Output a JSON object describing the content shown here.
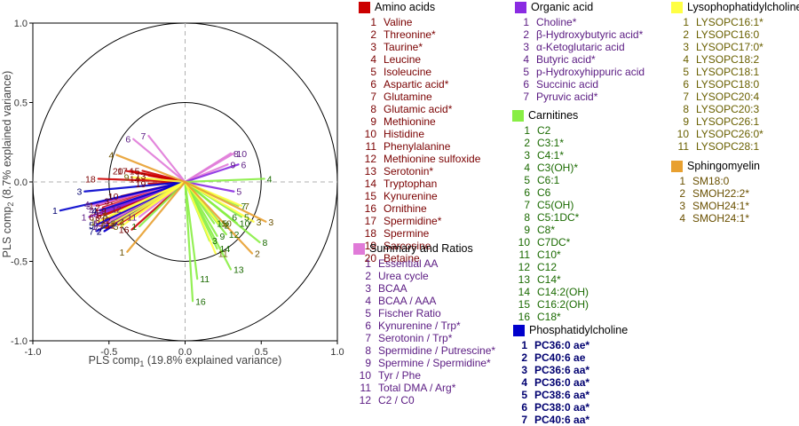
{
  "chart_data": {
    "type": "scatter",
    "subtype": "pls-correlation-loadings",
    "xlabel": "PLS comp",
    "xlabel_sub": "1",
    "xlabel_note": "(19.8% explained variance)",
    "ylabel": "PLS comp",
    "ylabel_sub": "2",
    "ylabel_note": "(8.7% explained variance)",
    "xlim": [
      -1.0,
      1.0
    ],
    "ylim": [
      -1.0,
      1.0
    ],
    "xticks": [
      "-1.0",
      "-0.5",
      "0.0",
      "0.5",
      "1.0"
    ],
    "yticks": [
      "1.0",
      "0.5",
      "0.0",
      "-0.5",
      "-1.0"
    ],
    "circles": [
      1.0,
      0.5
    ],
    "groups": [
      {
        "name": "Amino acids",
        "color": "#cc0000",
        "text_color": "#7a0000",
        "items": [
          "Valine",
          "Threonine*",
          "Taurine*",
          "Leucine",
          "Isoleucine",
          "Aspartic acid*",
          "Glutamine",
          "Glutamic acid*",
          "Methionine",
          "Histidine",
          "Phenylalanine",
          "Methionine sulfoxide",
          "Serotonin*",
          "Tryptophan",
          "Kynurenine",
          "Ornithine",
          "Spermidine*",
          "Spermine",
          "Sarcosine",
          "Betaine"
        ],
        "points": [
          {
            "label": "1",
            "x": -0.58,
            "y": -0.15
          },
          {
            "label": "2",
            "x": -0.54,
            "y": -0.16
          },
          {
            "label": "3",
            "x": -0.48,
            "y": -0.12
          },
          {
            "label": "4",
            "x": -0.55,
            "y": -0.19
          },
          {
            "label": "5",
            "x": -0.53,
            "y": -0.21
          },
          {
            "label": "6",
            "x": -0.58,
            "y": -0.22
          },
          {
            "label": "7",
            "x": -0.52,
            "y": -0.29
          },
          {
            "label": "8",
            "x": -0.54,
            "y": -0.24
          },
          {
            "label": "9",
            "x": -0.5,
            "y": -0.18
          },
          {
            "label": "10",
            "x": -0.42,
            "y": -0.09
          },
          {
            "label": "11",
            "x": -0.44,
            "y": -0.27
          },
          {
            "label": "12",
            "x": -0.47,
            "y": -0.24
          },
          {
            "label": "13",
            "x": -0.24,
            "y": 0.04
          },
          {
            "label": "14",
            "x": -0.28,
            "y": 0.02
          },
          {
            "label": "15",
            "x": -0.28,
            "y": 0.07
          },
          {
            "label": "16",
            "x": -0.35,
            "y": -0.3
          },
          {
            "label": "17",
            "x": -0.36,
            "y": 0.07
          },
          {
            "label": "18",
            "x": -0.57,
            "y": 0.02
          },
          {
            "label": "19",
            "x": -0.24,
            "y": -0.01
          },
          {
            "label": "20",
            "x": -0.39,
            "y": 0.07
          }
        ]
      },
      {
        "name": "Summary and Ratios",
        "color": "#e07ad8",
        "text_color": "#5a1a82",
        "items": [
          "Essential  AA",
          "Urea cycle",
          "BCAA",
          "BCAA / AAA",
          "Fischer Ratio",
          "Kynurenine / Trp*",
          "Serotonin / Trp*",
          "Spermidine / Putrescine*",
          "Spermine / Spermidine*",
          "Tyr / Phe",
          "Total DMA / Arg*",
          "C2 / C0"
        ],
        "points": [
          {
            "label": "1",
            "x": -0.56,
            "y": -0.28
          },
          {
            "label": "2",
            "x": -0.49,
            "y": -0.23
          },
          {
            "label": "3",
            "x": -0.6,
            "y": -0.15
          },
          {
            "label": "4",
            "x": -0.58,
            "y": -0.18
          },
          {
            "label": "5",
            "x": -0.55,
            "y": -0.26
          },
          {
            "label": "6",
            "x": -0.34,
            "y": 0.27
          },
          {
            "label": "7",
            "x": -0.24,
            "y": 0.29
          },
          {
            "label": "8",
            "x": 0.3,
            "y": 0.18
          },
          {
            "label": "9",
            "x": 0.28,
            "y": 0.11
          },
          {
            "label": "10",
            "x": 0.32,
            "y": 0.18
          },
          {
            "label": "11",
            "x": -0.3,
            "y": -0.22
          },
          {
            "label": "12",
            "x": -0.4,
            "y": -0.17
          }
        ]
      },
      {
        "name": "Organic acid",
        "color": "#8a2be2",
        "text_color": "#5a1a82",
        "items": [
          "Choline*",
          "β-Hydroxybutyric acid*",
          "α-Ketoglutaric acid",
          "Butyric acid*",
          "p-Hydroxyhippuric acid",
          "Succinic acid",
          "Pyruvic acid*"
        ],
        "points": [
          {
            "label": "1",
            "x": -0.63,
            "y": -0.22
          },
          {
            "label": "2",
            "x": -0.53,
            "y": -0.31
          },
          {
            "label": "3",
            "x": -0.55,
            "y": -0.2
          },
          {
            "label": "4",
            "x": -0.61,
            "y": -0.14
          },
          {
            "label": "5",
            "x": 0.32,
            "y": -0.06
          },
          {
            "label": "6",
            "x": 0.35,
            "y": 0.11
          },
          {
            "label": "7",
            "x": -0.55,
            "y": -0.29
          }
        ]
      },
      {
        "name": "Carnitines",
        "color": "#88ee44",
        "text_color": "#1a6a00",
        "items": [
          "C2",
          "C3:1*",
          "C4:1*",
          "C3(OH)*",
          "C6:1",
          "C6",
          "C5(OH)",
          "C5:1DC*",
          "C8*",
          "C7DC*",
          "C10*",
          "C12",
          "C14*",
          "C14:2(OH)",
          "C16:2(OH)",
          "C18*"
        ],
        "points": [
          {
            "label": "1",
            "x": -0.3,
            "y": -0.28
          },
          {
            "label": "2",
            "x": 0.24,
            "y": -0.27
          },
          {
            "label": "3",
            "x": 0.16,
            "y": -0.37
          },
          {
            "label": "4",
            "x": 0.52,
            "y": 0.02
          },
          {
            "label": "5",
            "x": 0.37,
            "y": -0.22
          },
          {
            "label": "6",
            "x": 0.29,
            "y": -0.22
          },
          {
            "label": "7",
            "x": 0.35,
            "y": -0.15
          },
          {
            "label": "8",
            "x": 0.49,
            "y": -0.38
          },
          {
            "label": "9",
            "x": 0.21,
            "y": -0.34
          },
          {
            "label": "10",
            "x": 0.34,
            "y": -0.26
          },
          {
            "label": "11",
            "x": 0.08,
            "y": -0.61
          },
          {
            "label": "12",
            "x": 0.27,
            "y": -0.33
          },
          {
            "label": "13",
            "x": 0.3,
            "y": -0.55
          },
          {
            "label": "14",
            "x": 0.21,
            "y": -0.42
          },
          {
            "label": "15",
            "x": 0.19,
            "y": -0.26
          },
          {
            "label": "16",
            "x": 0.05,
            "y": -0.75
          }
        ]
      },
      {
        "name": "Phosphatidylcholine",
        "color": "#0000cc",
        "text_color": "#000070",
        "items": [
          "PC36:0 ae*",
          "PC40:6 ae",
          "PC36:6 aa*",
          "PC36:0 aa*",
          "PC38:6 aa*",
          "PC38:0 aa*",
          "PC40:6 aa*"
        ],
        "points": [
          {
            "label": "1",
            "x": -0.82,
            "y": -0.18
          },
          {
            "label": "2",
            "x": -0.53,
            "y": -0.31
          },
          {
            "label": "3",
            "x": -0.66,
            "y": -0.06
          },
          {
            "label": "4",
            "x": -0.56,
            "y": -0.18
          },
          {
            "label": "5",
            "x": -0.58,
            "y": -0.27
          },
          {
            "label": "6",
            "x": -0.5,
            "y": -0.27
          },
          {
            "label": "7",
            "x": -0.58,
            "y": -0.31
          }
        ]
      },
      {
        "name": "Lysophophatidylcholine",
        "color": "#ffff44",
        "text_color": "#6a6000",
        "items": [
          "LYSOPC16:1*",
          "LYSOPC16:0",
          "LYSOPC17:0*",
          "LYSOPC18:2",
          "LYSOPC18:1",
          "LYSOPC18:0",
          "LYSOPC20:4",
          "LYSOPC20:3",
          "LYSOPC26:1",
          "LYSOPC26:0*",
          "LYSOPC28:1"
        ],
        "points": [
          {
            "label": "1",
            "x": -0.57,
            "y": -0.25
          },
          {
            "label": "2",
            "x": -0.44,
            "y": -0.26
          },
          {
            "label": "3",
            "x": 0.45,
            "y": -0.25
          },
          {
            "label": "4",
            "x": -0.38,
            "y": -0.25
          },
          {
            "label": "5",
            "x": -0.42,
            "y": -0.28
          },
          {
            "label": "6",
            "x": -0.5,
            "y": -0.27
          },
          {
            "label": "7",
            "x": 0.37,
            "y": -0.15
          },
          {
            "label": "8",
            "x": -0.49,
            "y": -0.21
          },
          {
            "label": "9",
            "x": -0.35,
            "y": 0.03
          },
          {
            "label": "10",
            "x": 0.22,
            "y": -0.26
          },
          {
            "label": "11",
            "x": 0.2,
            "y": -0.45
          }
        ]
      },
      {
        "name": "Sphingomyelin",
        "color": "#e8a030",
        "text_color": "#6a5000",
        "items": [
          "SM18:0",
          "SMOH22:2*",
          "SMOH24:1*",
          "SMOH24:1*"
        ],
        "points": [
          {
            "label": "1",
            "x": -0.38,
            "y": -0.44
          },
          {
            "label": "2",
            "x": 0.44,
            "y": -0.45
          },
          {
            "label": "3",
            "x": 0.53,
            "y": -0.25
          },
          {
            "label": "4",
            "x": -0.45,
            "y": 0.17
          }
        ]
      }
    ]
  }
}
